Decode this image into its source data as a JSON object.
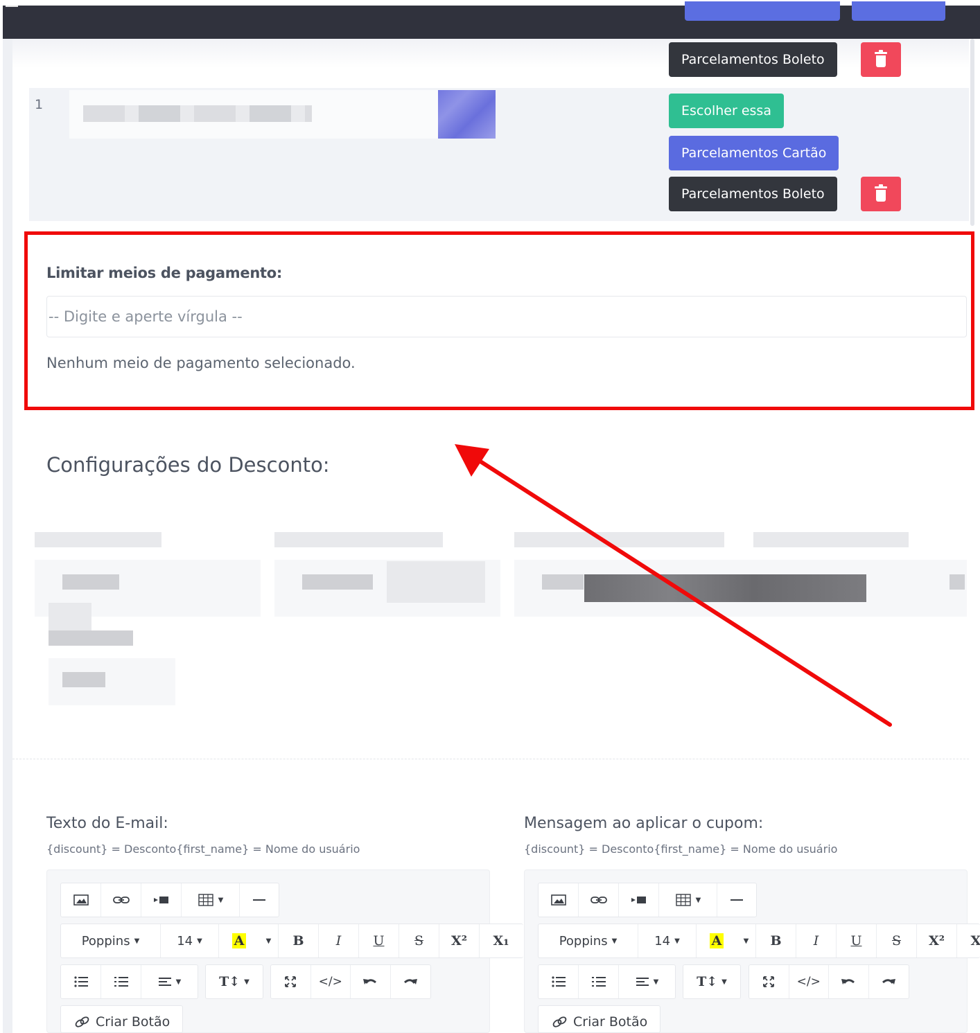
{
  "rows": {
    "top_row": {
      "boleto_label": "Parcelamentos Boleto"
    },
    "second_row": {
      "index": "1",
      "choose_label": "Escolher essa",
      "cartao_label": "Parcelamentos Cartão",
      "boleto_label": "Parcelamentos Boleto"
    }
  },
  "payment_limit": {
    "label": "Limitar meios de pagamento:",
    "placeholder": "-- Digite e aperte vírgula --",
    "empty_message": "Nenhum meio de pagamento selecionado."
  },
  "discount": {
    "title": "Configurações do Desconto:"
  },
  "editors": {
    "email": {
      "label": "Texto do E-mail:",
      "hint": "{discount} = Desconto{first_name} = Nome do usuário"
    },
    "coupon": {
      "label": "Mensagem ao aplicar o cupom:",
      "hint": "{discount} = Desconto{first_name} = Nome do usuário"
    },
    "toolbar": {
      "font_family": "Poppins",
      "font_size": "14",
      "color_letter": "A",
      "bold": "B",
      "italic": "I",
      "underline": "U",
      "strike": "S",
      "superscript": "X²",
      "subscript": "X₁",
      "line_height": "T↕",
      "code": "</>",
      "create_button": "Criar Botão"
    }
  },
  "colors": {
    "topbar": "#30323d",
    "dark_button": "#33363d",
    "green_button": "#2fbf92",
    "blue_button": "#5a6be0",
    "delete_button": "#f1485b",
    "highlight_annotation": "#f00a0a"
  },
  "icons": [
    "trash-icon",
    "image-icon",
    "link-icon",
    "video-icon",
    "table-icon",
    "horizontal-rule-icon",
    "unordered-list-icon",
    "ordered-list-icon",
    "align-icon",
    "fullscreen-icon",
    "undo-icon",
    "redo-icon"
  ]
}
